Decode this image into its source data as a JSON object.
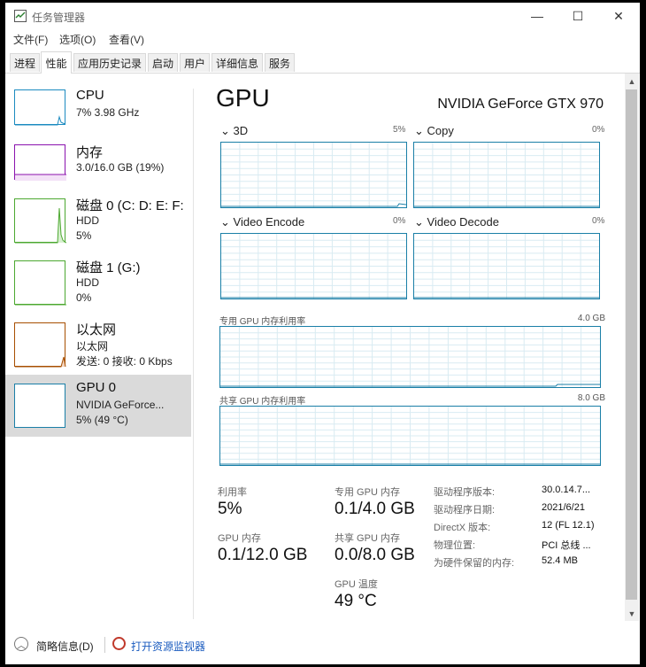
{
  "window": {
    "title": "任务管理器",
    "min_glyph": "—",
    "max_glyph": "☐",
    "close_glyph": "✕"
  },
  "menu": [
    "文件(F)",
    "选项(O)",
    "查看(V)"
  ],
  "tabs": [
    "进程",
    "性能",
    "应用历史记录",
    "启动",
    "用户",
    "详细信息",
    "服务"
  ],
  "active_tab": "性能",
  "resources": [
    {
      "title": "CPU",
      "line1": "7% 3.98 GHz",
      "line2": "",
      "color": "#1c8bc0"
    },
    {
      "title": "内存",
      "line1": "3.0/16.0 GB (19%)",
      "line2": "",
      "color": "#8b12ae"
    },
    {
      "title": "磁盘 0 (C: D: E: F:",
      "line1": "HDD",
      "line2": "5%",
      "color": "#4ca830"
    },
    {
      "title": "磁盘 1 (G:)",
      "line1": "HDD",
      "line2": "0%",
      "color": "#4ca830"
    },
    {
      "title": "以太网",
      "line1": "以太网",
      "line2": "发送: 0 接收: 0 Kbps",
      "color": "#a74f01"
    },
    {
      "title": "GPU 0",
      "line1": "NVIDIA GeForce...",
      "line2": "5% (49 °C)",
      "color": "#1a7fa7"
    }
  ],
  "gpu": {
    "title": "GPU",
    "name": "NVIDIA GeForce GTX 970",
    "engines": [
      {
        "label": "3D",
        "pct": "5%"
      },
      {
        "label": "Copy",
        "pct": "0%"
      },
      {
        "label": "Video Encode",
        "pct": "0%"
      },
      {
        "label": "Video Decode",
        "pct": "0%"
      }
    ],
    "dedicated_label": "专用 GPU 内存利用率",
    "dedicated_max": "4.0 GB",
    "shared_label": "共享 GPU 内存利用率",
    "shared_max": "8.0 GB",
    "stats": {
      "util_label": "利用率",
      "util_value": "5%",
      "dedicated_label": "专用 GPU 内存",
      "dedicated_value": "0.1/4.0 GB",
      "gpu_mem_label": "GPU 内存",
      "gpu_mem_value": "0.1/12.0 GB",
      "shared_label": "共享 GPU 内存",
      "shared_value": "0.0/8.0 GB",
      "temp_label": "GPU 温度",
      "temp_value": "49 °C"
    },
    "info": [
      {
        "k": "驱动程序版本:",
        "v": "30.0.14.7..."
      },
      {
        "k": "驱动程序日期:",
        "v": "2021/6/21"
      },
      {
        "k": "DirectX 版本:",
        "v": "12 (FL 12.1)"
      },
      {
        "k": "物理位置:",
        "v": "PCI 总线 ..."
      },
      {
        "k": "为硬件保留的内存:",
        "v": "52.4 MB"
      }
    ]
  },
  "footer": {
    "fewer": "简略信息(D)",
    "resmon": "打开资源监视器"
  }
}
